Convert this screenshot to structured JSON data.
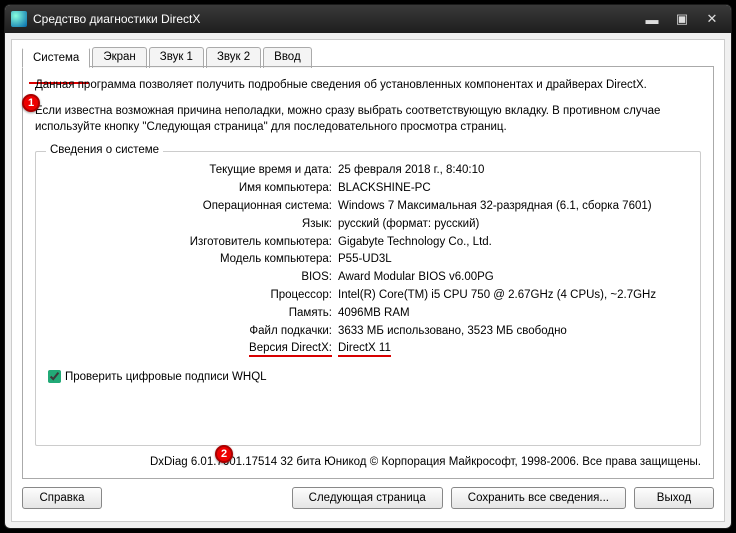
{
  "window": {
    "title": "Средство диагностики DirectX"
  },
  "tabs": [
    "Система",
    "Экран",
    "Звук 1",
    "Звук 2",
    "Ввод"
  ],
  "desc1": "Данная программа позволяет получить подробные сведения об установленных компонентах и драйверах DirectX.",
  "desc2": "Если известна возможная причина неполадки, можно сразу выбрать соответствующую вкладку. В противном случае используйте кнопку \"Следующая страница\" для последовательного просмотра страниц.",
  "fieldset_legend": "Сведения о системе",
  "info": [
    {
      "label": "Текущие время и дата:",
      "value": "25 февраля 2018 г., 8:40:10"
    },
    {
      "label": "Имя компьютера:",
      "value": "BLACKSHINE-PC"
    },
    {
      "label": "Операционная система:",
      "value": "Windows 7 Максимальная 32-разрядная (6.1, сборка 7601)"
    },
    {
      "label": "Язык:",
      "value": "русский (формат: русский)"
    },
    {
      "label": "Изготовитель компьютера:",
      "value": "Gigabyte Technology Co., Ltd."
    },
    {
      "label": "Модель компьютера:",
      "value": "P55-UD3L"
    },
    {
      "label": "BIOS:",
      "value": "Award Modular BIOS v6.00PG"
    },
    {
      "label": "Процессор:",
      "value": "Intel(R) Core(TM) i5 CPU       750  @ 2.67GHz (4 CPUs), ~2.7GHz"
    },
    {
      "label": "Память:",
      "value": "4096MB RAM"
    },
    {
      "label": "Файл подкачки:",
      "value": "3633 МБ использовано, 3523 МБ свободно"
    },
    {
      "label": "Версия DirectX:",
      "value": "DirectX 11"
    }
  ],
  "check_label": "Проверить цифровые подписи WHQL",
  "footer": "DxDiag 6.01.7601.17514 32 бита Юникод  © Корпорация Майкрософт, 1998-2006.  Все права защищены.",
  "buttons": {
    "help": "Справка",
    "next": "Следующая страница",
    "save": "Сохранить все сведения...",
    "exit": "Выход"
  },
  "markers": {
    "one": "1",
    "two": "2"
  }
}
